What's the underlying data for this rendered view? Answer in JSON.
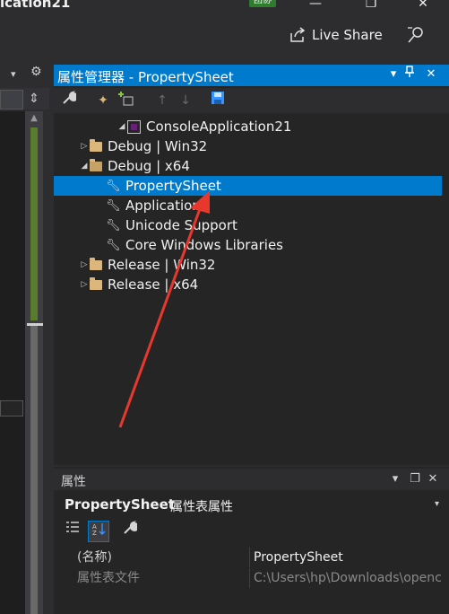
{
  "window": {
    "title": "ication21",
    "badge": "团协",
    "minimize": "—",
    "maximize": "❐",
    "close": "✕"
  },
  "toolbar_top": {
    "live_share_label": "Live Share",
    "live_share_icon": "share-icon",
    "feedback_icon": "feedback-icon"
  },
  "left_pane": {
    "dropdown": "▾",
    "gear": "⚙",
    "sync": "⇕"
  },
  "property_manager": {
    "title": "属性管理器 - PropertySheet",
    "controls": [
      "▾",
      "📌",
      "✕"
    ],
    "toolbar": [
      "wrench-icon",
      "add-new-property-sheet-icon",
      "add-existing-property-sheet-icon",
      "move-up-icon",
      "move-down-icon",
      "save-icon"
    ],
    "tree": {
      "root": "ConsoleApplication21",
      "nodes": [
        {
          "label": "Debug | Win32",
          "kind": "folder",
          "expanded": false
        },
        {
          "label": "Debug | x64",
          "kind": "folder",
          "expanded": true
        },
        {
          "label": "PropertySheet",
          "kind": "sheet",
          "selected": true
        },
        {
          "label": "Application",
          "kind": "sheet"
        },
        {
          "label": "Unicode Support",
          "kind": "sheet"
        },
        {
          "label": "Core Windows Libraries",
          "kind": "sheet"
        },
        {
          "label": "Release | Win32",
          "kind": "folder",
          "expanded": false
        },
        {
          "label": "Release | x64",
          "kind": "folder",
          "expanded": false
        }
      ]
    }
  },
  "properties": {
    "title": "属性",
    "controls": [
      "▾",
      "❐",
      "✕"
    ],
    "object_name": "PropertySheet",
    "object_type": "属性表属性",
    "dropdown": "▾",
    "rows": [
      {
        "name": "(名称)",
        "value": "PropertySheet"
      },
      {
        "name": "属性表文件",
        "value": "C:\\Users\\hp\\Downloads\\openc"
      }
    ]
  },
  "annotation": {
    "color": "#e8382e"
  }
}
